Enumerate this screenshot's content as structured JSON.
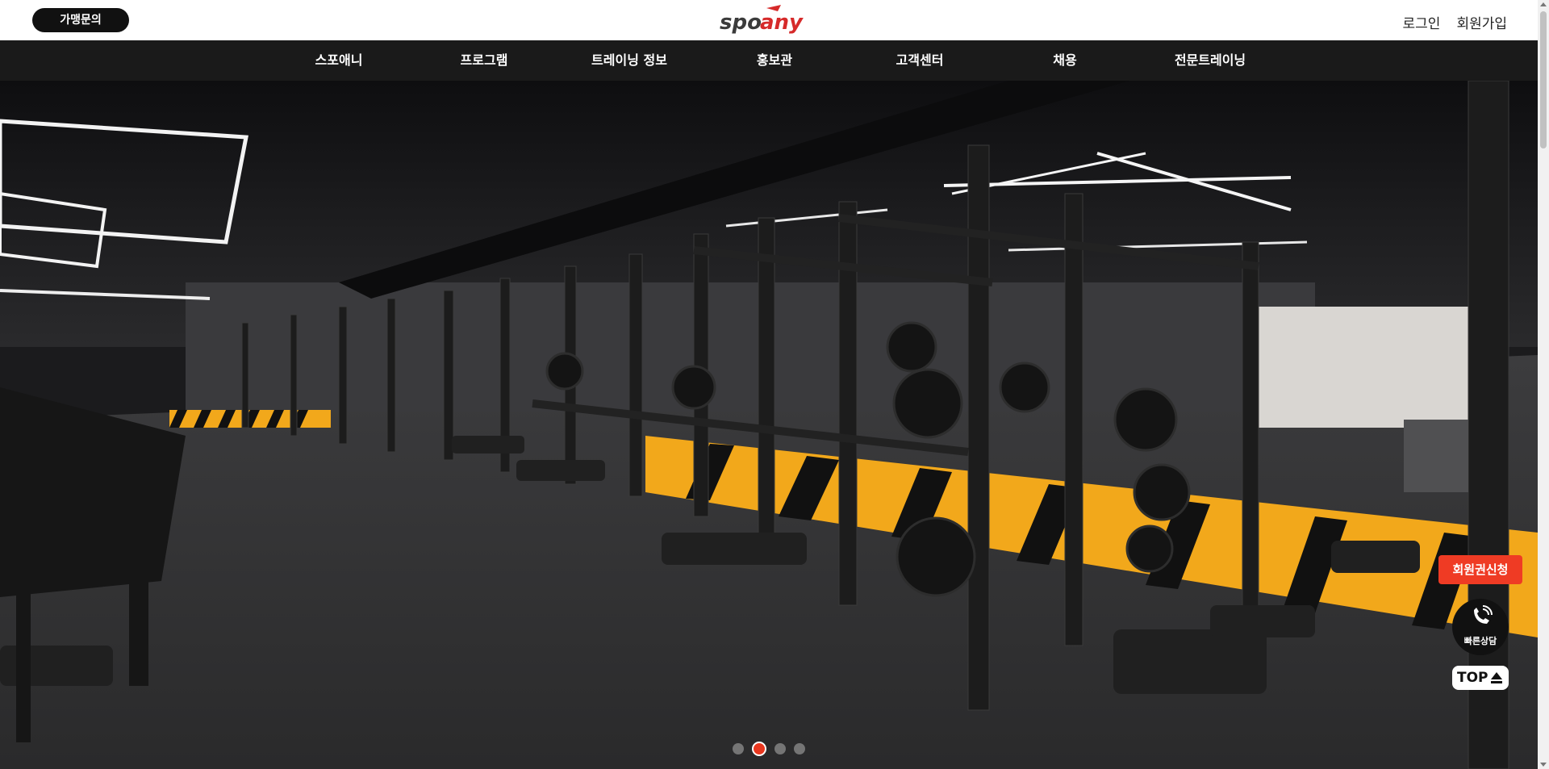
{
  "header": {
    "franchise_label": "가맹문의",
    "logo_text": "spoany",
    "login_label": "로그인",
    "signup_label": "회원가입"
  },
  "nav": {
    "items": [
      {
        "label": "스포애니"
      },
      {
        "label": "프로그램"
      },
      {
        "label": "트레이닝 정보"
      },
      {
        "label": "홍보관"
      },
      {
        "label": "고객센터"
      },
      {
        "label": "채용"
      },
      {
        "label": "전문트레이닝"
      }
    ]
  },
  "hero": {
    "slide_count": 4,
    "active_slide": 2
  },
  "floating": {
    "membership_label": "회원권신청",
    "consult_label": "빠른상담",
    "top_label": "TOP"
  },
  "colors": {
    "brand_red": "#e8371f",
    "nav_bg": "#1a1a1a",
    "accent_yellow": "#f2a81b"
  }
}
